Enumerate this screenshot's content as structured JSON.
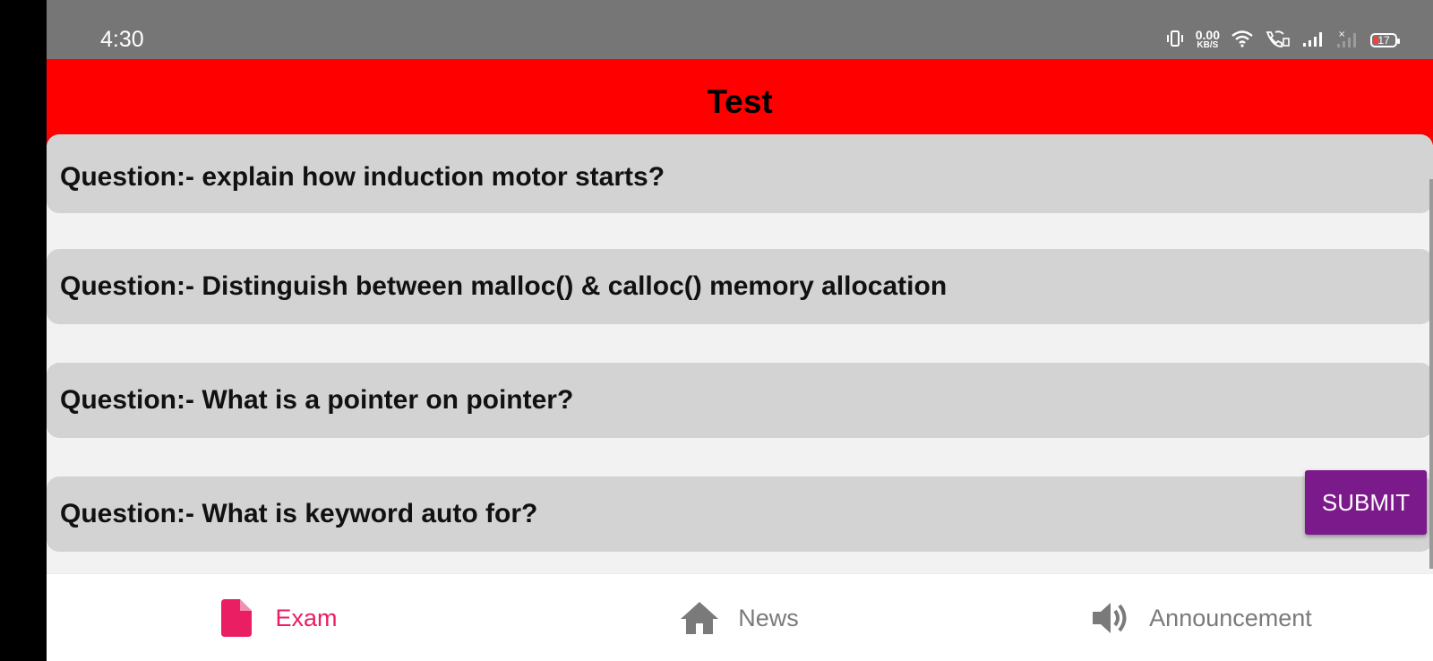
{
  "status_bar": {
    "time": "4:30",
    "net_speed_value": "0.00",
    "net_speed_unit": "KB/S",
    "battery_level": "17",
    "icons": [
      "vibrate-icon",
      "wifi-icon",
      "wifi-calling-icon",
      "signal-icon",
      "no-signal-icon",
      "battery-icon"
    ]
  },
  "app_bar": {
    "title": "Test",
    "color": "#ff0000"
  },
  "questions": [
    {
      "text": "Question:- explain how induction motor starts?"
    },
    {
      "text": "Question:- Distinguish between malloc() & calloc() memory allocation"
    },
    {
      "text": "Question:- What is a pointer on pointer?"
    },
    {
      "text": "Question:- What is keyword auto for?"
    }
  ],
  "submit_button": {
    "label": "SUBMIT",
    "color": "#7b1a8a"
  },
  "bottom_nav": {
    "active_color": "#e91e63",
    "items": [
      {
        "label": "Exam",
        "icon": "document-icon",
        "active": true
      },
      {
        "label": "News",
        "icon": "home-icon",
        "active": false
      },
      {
        "label": "Announcement",
        "icon": "speaker-icon",
        "active": false
      }
    ]
  }
}
